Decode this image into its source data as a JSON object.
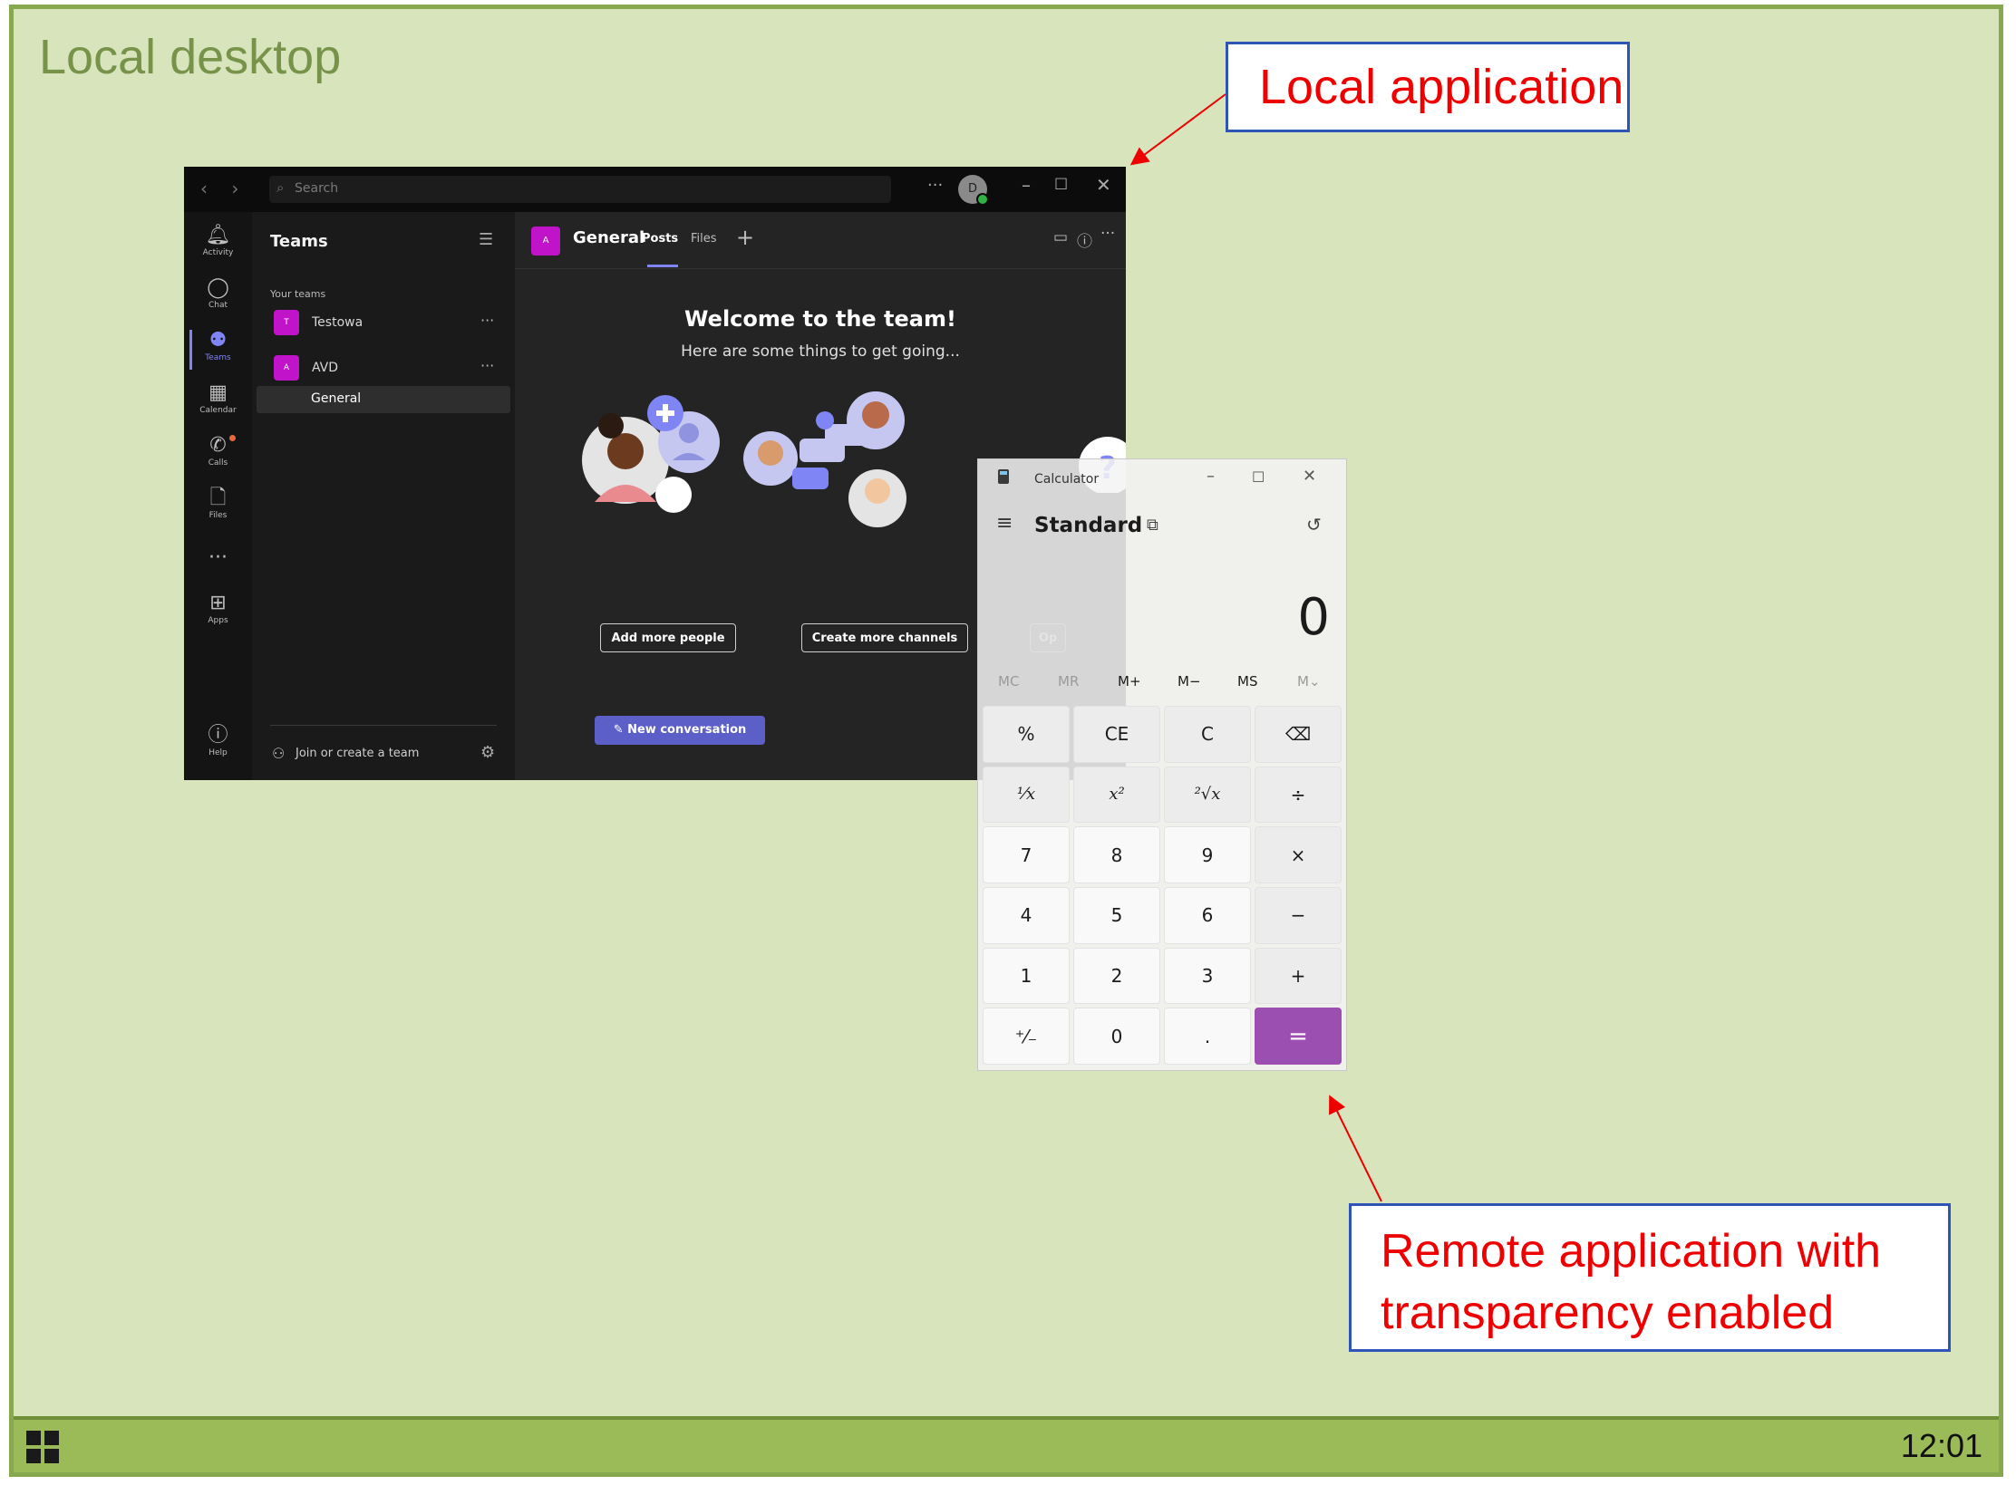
{
  "desktop": {
    "label": "Local desktop",
    "clock": "12:01"
  },
  "callouts": {
    "local": "Local application",
    "remote_line1": "Remote application with",
    "remote_line2": "transparency enabled"
  },
  "colors": {
    "accent_teams": "#7f85f5",
    "teams_avatar": "#c113c9",
    "calc_equals": "#9b4fb0",
    "callout_text": "#ee0000",
    "desktop_bg": "#d8e4bc"
  },
  "teams": {
    "search_placeholder": "Search",
    "more": "···",
    "avatar_initial": "D",
    "rail": [
      {
        "label": "Activity",
        "icon": "bell-icon"
      },
      {
        "label": "Chat",
        "icon": "chat-icon"
      },
      {
        "label": "Teams",
        "icon": "teams-icon"
      },
      {
        "label": "Calendar",
        "icon": "calendar-icon"
      },
      {
        "label": "Calls",
        "icon": "phone-icon"
      },
      {
        "label": "Files",
        "icon": "file-icon"
      },
      {
        "label": "···",
        "icon": "more-icon"
      },
      {
        "label": "Apps",
        "icon": "apps-icon"
      },
      {
        "label": "Help",
        "icon": "help-icon"
      }
    ],
    "sidebar": {
      "title": "Teams",
      "section": "Your teams",
      "teams": [
        {
          "initial": "T",
          "name": "Testowa",
          "more": "···"
        },
        {
          "initial": "A",
          "name": "AVD",
          "more": "···"
        }
      ],
      "channel": "General",
      "join": "Join or create a team"
    },
    "channel": {
      "initial": "A",
      "name": "General",
      "tabs": [
        "Posts",
        "Files"
      ],
      "welcome_title": "Welcome to the team!",
      "welcome_sub": "Here are some things to get going...",
      "add_people": "Add more people",
      "create_channels": "Create more channels",
      "new_conversation": "New conversation",
      "more": "···",
      "partial_button": "Op"
    }
  },
  "calculator": {
    "title": "Calculator",
    "mode": "Standard",
    "display": "0",
    "memory": [
      "MC",
      "MR",
      "M+",
      "M−",
      "MS",
      "M⌄"
    ],
    "keys": [
      "%",
      "CE",
      "C",
      "⌫",
      "¹⁄x",
      "x²",
      "²√x",
      "÷",
      "7",
      "8",
      "9",
      "×",
      "4",
      "5",
      "6",
      "−",
      "1",
      "2",
      "3",
      "+",
      "⁺⁄₋",
      "0",
      ".",
      "="
    ]
  }
}
